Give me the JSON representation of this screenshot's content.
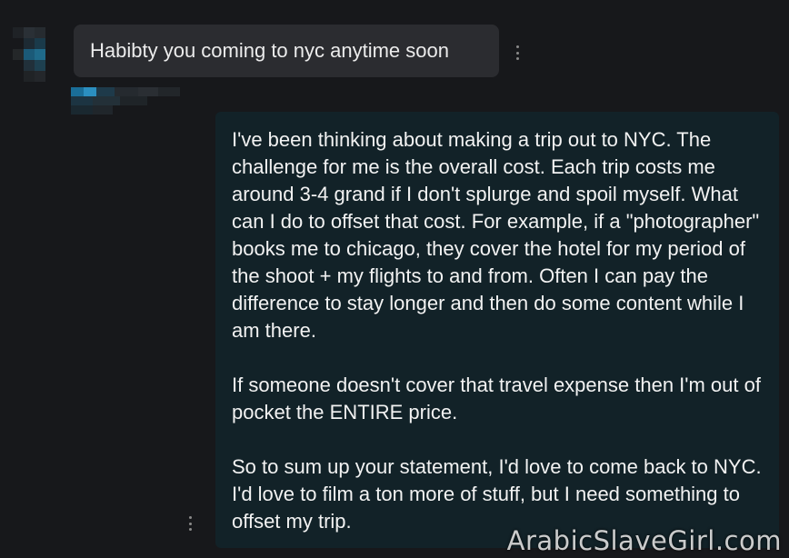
{
  "incoming_message": {
    "text": "Habibty you coming to nyc anytime soon"
  },
  "outgoing_message": {
    "paragraphs": [
      "I've been thinking about making a trip out to NYC. The challenge for me is the overall cost. Each trip costs me around 3-4 grand if I don't splurge and spoil myself. What can I do to offset that cost. For example, if a \"photographer\" books me to chicago, they cover the hotel for my period of the shoot + my flights to and from. Often I can pay the difference to stay longer and then do some content while I am there.",
      "If someone doesn't cover that travel expense then I'm out of pocket the ENTIRE price.",
      "So to sum up your statement, I'd love to come back to NYC. I'd love to film a ton more of stuff, but I need something to offset my trip."
    ]
  },
  "watermark": "ArabicSlaveGirl.com",
  "icons": {
    "more_options": "kebab-vertical-icon",
    "avatar": "blurred-avatar"
  },
  "colors": {
    "background": "#17181b",
    "incoming_bubble": "#2b2c30",
    "outgoing_bubble": "#122228",
    "text": "#f2f2f2"
  }
}
